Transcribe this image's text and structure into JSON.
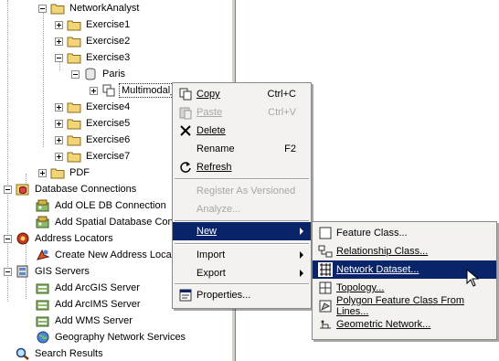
{
  "tree": {
    "items": [
      {
        "label": "NetworkAnalyst"
      },
      {
        "label": "Exercise1"
      },
      {
        "label": "Exercise2"
      },
      {
        "label": "Exercise3"
      },
      {
        "label": "Paris"
      },
      {
        "label": "Multimodal_Network"
      },
      {
        "label": "Exercise4"
      },
      {
        "label": "Exercise5"
      },
      {
        "label": "Exercise6"
      },
      {
        "label": "Exercise7"
      },
      {
        "label": "PDF"
      },
      {
        "label": "Database Connections"
      },
      {
        "label": "Add OLE DB Connection"
      },
      {
        "label": "Add Spatial Database Conne"
      },
      {
        "label": "Address Locators"
      },
      {
        "label": "Create New Address Locator"
      },
      {
        "label": "GIS Servers"
      },
      {
        "label": "Add ArcGIS Server"
      },
      {
        "label": "Add ArcIMS Server"
      },
      {
        "label": "Add WMS Server"
      },
      {
        "label": "Geography Network Services"
      },
      {
        "label": "Search Results"
      }
    ]
  },
  "context_menu": {
    "copy": {
      "label": "Copy",
      "shortcut": "Ctrl+C"
    },
    "paste": {
      "label": "Paste",
      "shortcut": "Ctrl+V"
    },
    "delete": {
      "label": "Delete"
    },
    "rename": {
      "label": "Rename",
      "shortcut": "F2"
    },
    "refresh": {
      "label": "Refresh"
    },
    "register": {
      "label": "Register As Versioned"
    },
    "analyze": {
      "label": "Analyze..."
    },
    "new": {
      "label": "New"
    },
    "import": {
      "label": "Import"
    },
    "export": {
      "label": "Export"
    },
    "properties": {
      "label": "Properties..."
    }
  },
  "submenu": {
    "feature_class": {
      "label": "Feature Class..."
    },
    "relationship_class": {
      "label": "Relationship Class..."
    },
    "network_dataset": {
      "label": "Network Dataset..."
    },
    "topology": {
      "label": "Topology..."
    },
    "polygon_fc": {
      "label": "Polygon Feature Class From Lines..."
    },
    "geometric_network": {
      "label": "Geometric Network..."
    }
  },
  "colors": {
    "highlight": "#0a246a",
    "folder": "#f2d577",
    "disabled": "#a7a7a7"
  }
}
